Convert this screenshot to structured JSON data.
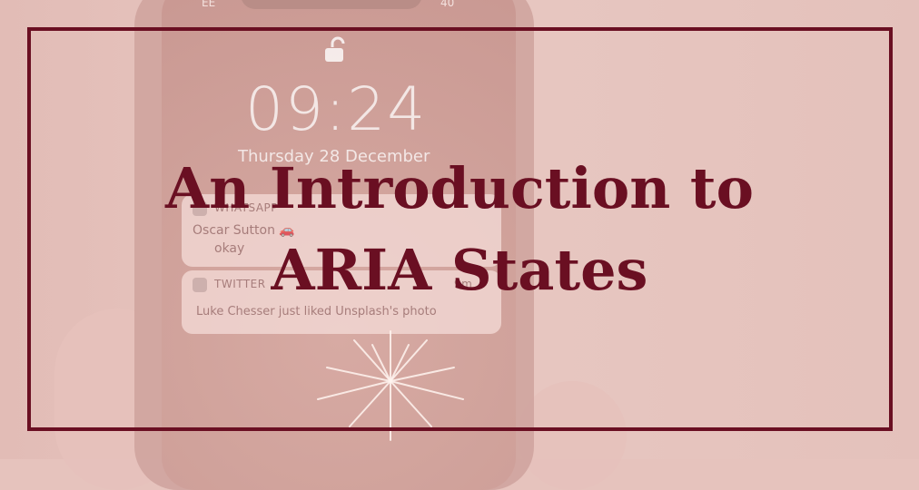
{
  "background": {
    "status_left": "EE",
    "status_right": "40",
    "clock": "09:24",
    "date": "Thursday 28 December",
    "notifications": [
      {
        "app": "WHATSAPP",
        "title": "Oscar Sutton 🚗",
        "body": "okay"
      },
      {
        "app": "TWITTER",
        "time": "9m",
        "body": "Luke Chesser just liked Unsplash's photo"
      }
    ]
  },
  "title": {
    "line1": "An Introduction to",
    "line2": "ARIA States"
  },
  "colors": {
    "accent": "#6a0f22",
    "background": "#e6c3bd"
  }
}
